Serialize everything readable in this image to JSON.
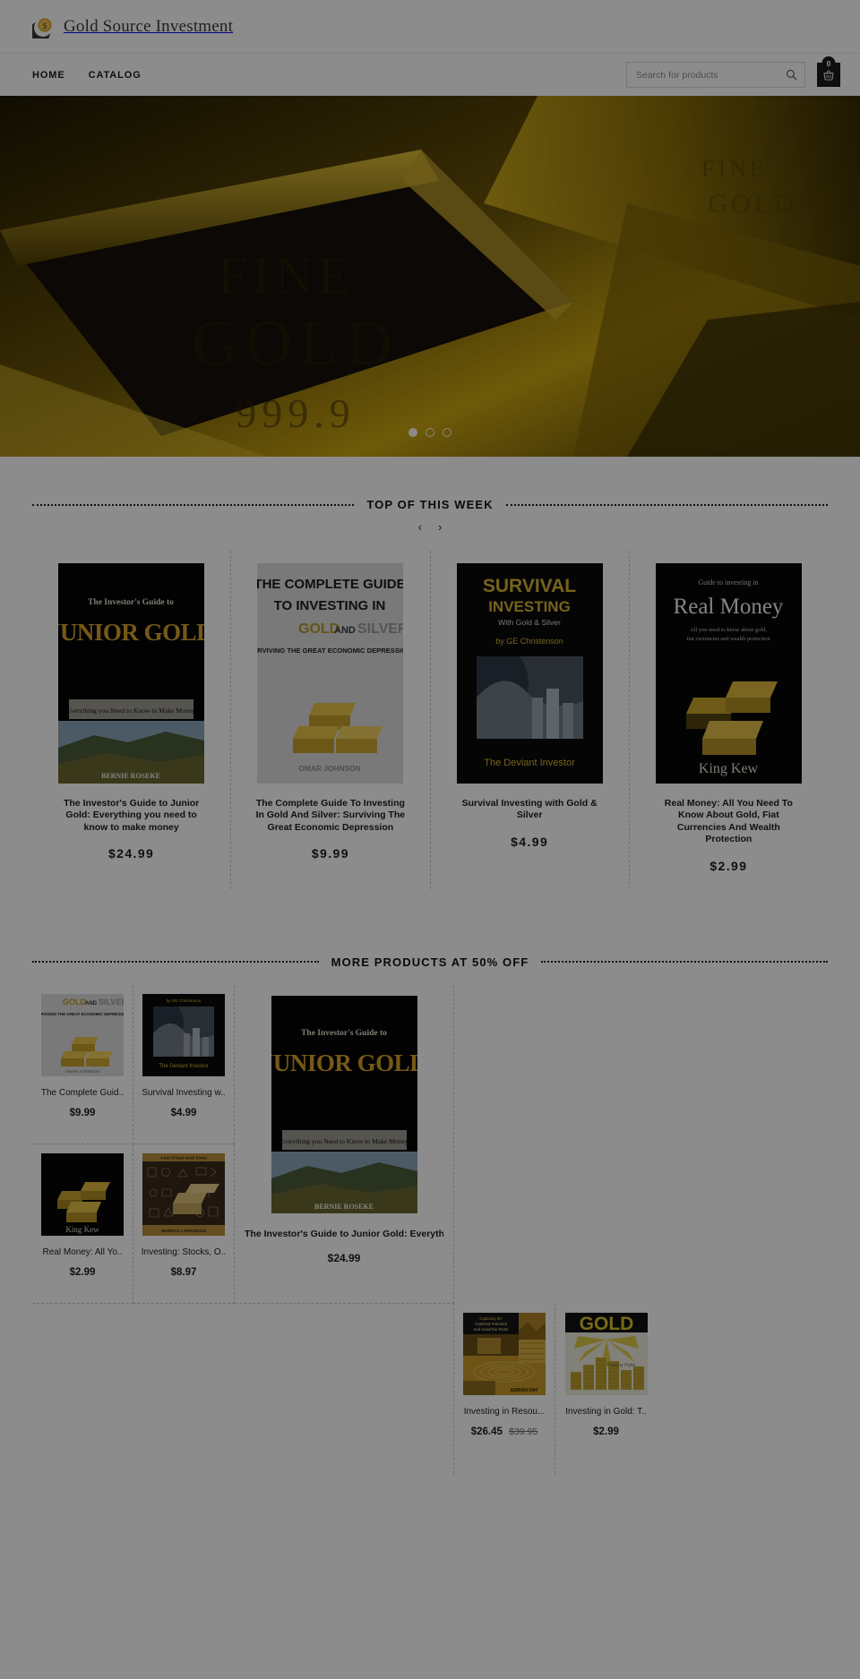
{
  "site": {
    "brand": "Gold Source Investment",
    "logo_icon": "gold-coin-icon",
    "accent_gold": "#c9a227",
    "dim_overlay": "rgba(0,0,0,0.45)"
  },
  "nav": {
    "links": [
      {
        "label": "HOME",
        "name": "home"
      },
      {
        "label": "CATALOG",
        "name": "catalog"
      }
    ]
  },
  "search": {
    "placeholder": "Search for products",
    "value": "",
    "icon": "search-icon"
  },
  "cart": {
    "count": "0",
    "icon": "shopping-basket-icon"
  },
  "hero": {
    "alt": "gold bullion bars fine gold 999.9",
    "slides": 3,
    "active_slide": 1
  },
  "sections": [
    {
      "title": "TOP OF THIS WEEK",
      "prev_arrow": "‹",
      "next_arrow": "›"
    },
    {
      "title": "MORE PRODUCTS AT 50% OFF"
    }
  ],
  "top_products": [
    {
      "title": "The Investor's Guide to Junior Gold: Everything you need to know to make money",
      "price": "$24.99",
      "cover": "junior-gold"
    },
    {
      "title": "The Complete Guide To Investing In Gold And Silver: Surviving The Great Economic Depression",
      "price": "$9.99",
      "cover": "gold-and-silver"
    },
    {
      "title": "Survival Investing with Gold & Silver",
      "price": "$4.99",
      "cover": "survival-investing"
    },
    {
      "title": "Real Money: All You Need To Know About Gold, Fiat Currencies And Wealth Protection",
      "price": "$2.99",
      "cover": "real-money"
    }
  ],
  "sale_products": [
    {
      "title": "The Complete Guid..",
      "price": "$9.99",
      "old_price": "",
      "cover": "gold-and-silver"
    },
    {
      "title": "Survival Investing w..",
      "price": "$4.99",
      "old_price": "",
      "cover": "survival-investing"
    },
    {
      "title": "Real Money: All Yo..",
      "price": "$2.99",
      "old_price": "",
      "cover": "real-money"
    },
    {
      "title": "Investing: Stocks, O..",
      "price": "$8.97",
      "old_price": "",
      "cover": "investing-stocks"
    },
    {
      "title": "Investing in Resou...",
      "price": "$26.45",
      "old_price": "$39.95",
      "cover": "investing-resources"
    },
    {
      "title": "Investing in Gold: T..",
      "price": "$2.99",
      "old_price": "",
      "cover": "investing-in-gold"
    }
  ],
  "featured_product": {
    "title": "The Investor's Guide to Junior Gold: Everything you ..",
    "price": "$24.99",
    "cover": "junior-gold"
  }
}
